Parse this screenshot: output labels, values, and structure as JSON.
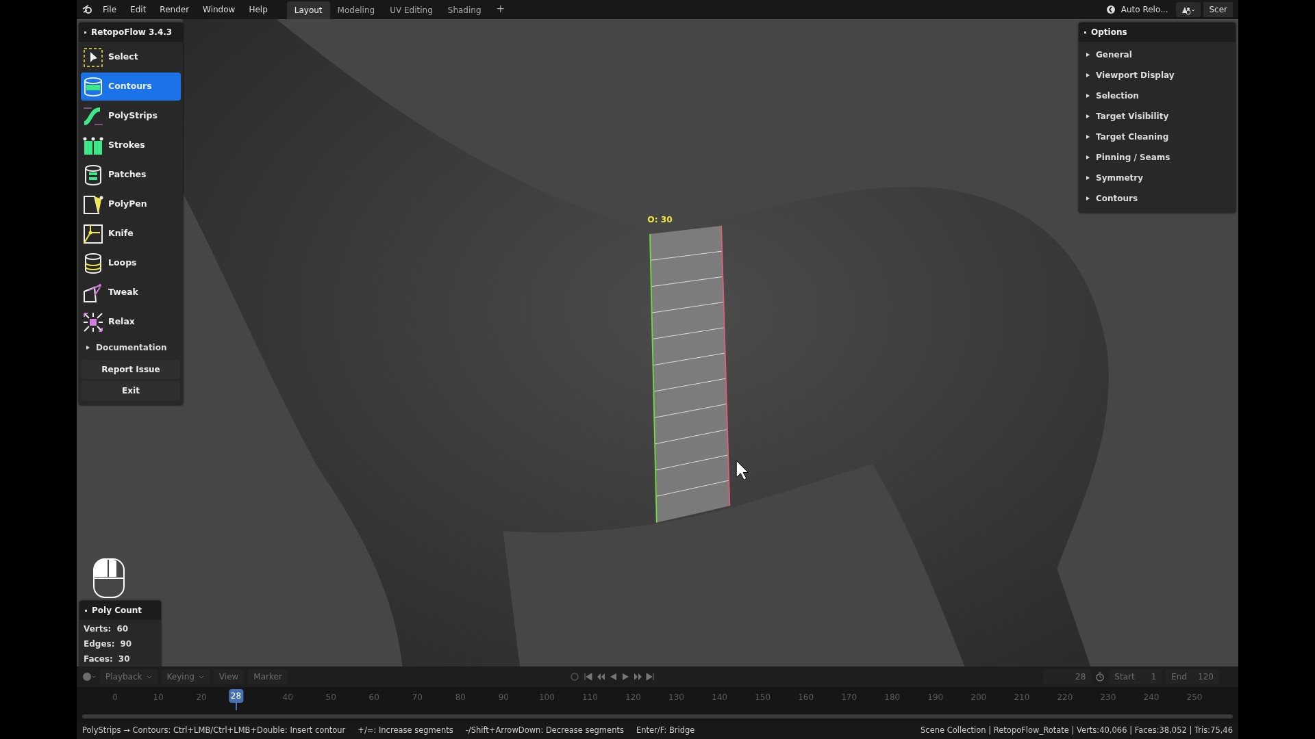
{
  "menubar": {
    "items": [
      "File",
      "Edit",
      "Render",
      "Window",
      "Help"
    ]
  },
  "workspaces": [
    {
      "label": "Layout",
      "selected": true
    },
    {
      "label": "Modeling",
      "selected": false
    },
    {
      "label": "UV Editing",
      "selected": false
    },
    {
      "label": "Shading",
      "selected": false
    }
  ],
  "add_workspace": "+",
  "header_right": {
    "auto_reload": "Auto Relo...",
    "scene": "Scer"
  },
  "tools_panel": {
    "title": "RetopoFlow 3.4.3",
    "tools": [
      {
        "label": "Select",
        "selected": false
      },
      {
        "label": "Contours",
        "selected": true
      },
      {
        "label": "PolyStrips",
        "selected": false
      },
      {
        "label": "Strokes",
        "selected": false
      },
      {
        "label": "Patches",
        "selected": false
      },
      {
        "label": "PolyPen",
        "selected": false
      },
      {
        "label": "Knife",
        "selected": false
      },
      {
        "label": "Loops",
        "selected": false
      },
      {
        "label": "Tweak",
        "selected": false
      },
      {
        "label": "Relax",
        "selected": false
      }
    ],
    "documentation": {
      "label": "Documentation",
      "expanded": false
    },
    "buttons": [
      "Report Issue",
      "Exit"
    ]
  },
  "options_panel": {
    "title": "Options",
    "sections": [
      {
        "label": "General",
        "expanded": false
      },
      {
        "label": "Viewport Display",
        "expanded": false
      },
      {
        "label": "Selection",
        "expanded": false
      },
      {
        "label": "Target Visibility",
        "expanded": false
      },
      {
        "label": "Target Cleaning",
        "expanded": false
      },
      {
        "label": "Pinning / Seams",
        "expanded": false
      },
      {
        "label": "Symmetry",
        "expanded": false
      },
      {
        "label": "Contours",
        "expanded": false
      }
    ]
  },
  "viewport": {
    "contour_label": "O: 30"
  },
  "poly_count": {
    "title": "Poly Count",
    "rows": [
      {
        "label": "Verts:",
        "value": "60"
      },
      {
        "label": "Edges:",
        "value": "90"
      },
      {
        "label": "Faces:",
        "value": "30"
      }
    ]
  },
  "timeline": {
    "menus": [
      {
        "label": "Playback",
        "dropdown": true
      },
      {
        "label": "Keying",
        "dropdown": true
      },
      {
        "label": "View",
        "dropdown": false
      },
      {
        "label": "Marker",
        "dropdown": false
      }
    ],
    "current_frame": "28",
    "start_label": "Start",
    "start": "1",
    "end_label": "End",
    "end": "120",
    "ticks": [
      "0",
      "10",
      "20",
      "40",
      "50",
      "60",
      "70",
      "80",
      "90",
      "100",
      "110",
      "120",
      "130",
      "140",
      "150",
      "160",
      "170",
      "180",
      "190",
      "200",
      "210",
      "220",
      "230",
      "240",
      "250"
    ],
    "playhead": "28"
  },
  "status_bar": {
    "hints": [
      "PolyStrips → Contours: Ctrl+LMB/Ctrl+LMB+Double: Insert contour",
      "+/=: Increase segments",
      "-/Shift+ArrowDown: Decrease segments",
      "Enter/F: Bridge"
    ],
    "stats": "Scene Collection | RetopoFlow_Rotate | Verts:40,066 | Faces:38,052 | Tris:75,46"
  }
}
